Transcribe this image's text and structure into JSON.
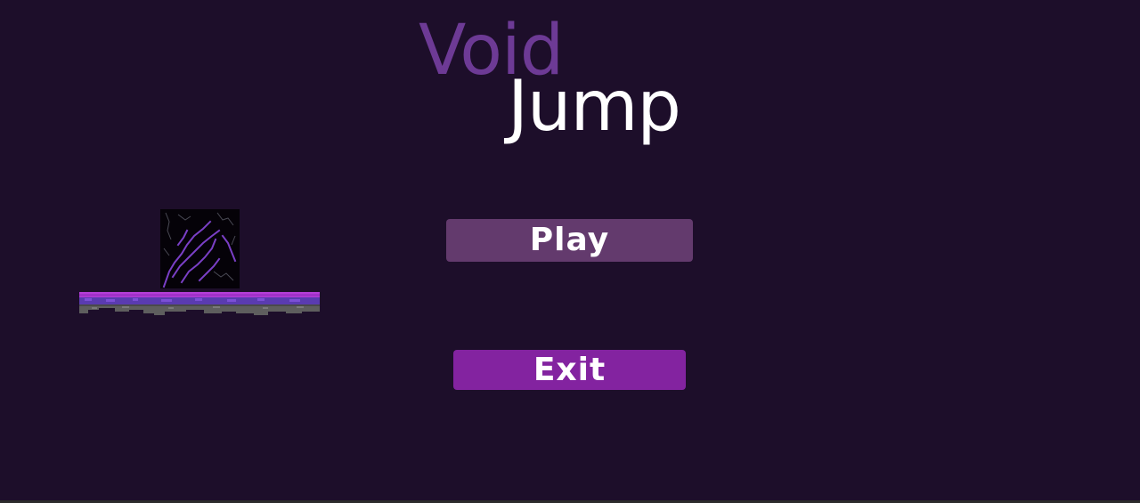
{
  "title": {
    "word1": "Void",
    "word2": "Jump"
  },
  "menu": {
    "play_label": "Play",
    "exit_label": "Exit"
  },
  "colors": {
    "background": "#1d0e2a",
    "title_void": "#6d3a95",
    "title_jump": "#ffffff",
    "play_button": "#633a6d",
    "exit_button": "#8323a0",
    "platform_top": "#b43ed8",
    "platform_rock": "#5e5e5e",
    "crack": "#7a3fc6"
  },
  "sprites": {
    "player": "void-cube-sprite",
    "platform": "void-platform-tile"
  }
}
